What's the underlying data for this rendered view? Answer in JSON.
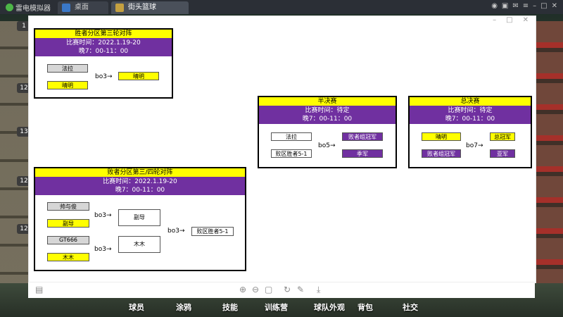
{
  "titlebar": {
    "brand": "雷电模拟器",
    "tabs": [
      {
        "label": "桌面"
      },
      {
        "label": "街头篮球"
      }
    ]
  },
  "background": {
    "left_badges": [
      "1",
      "12",
      "13",
      "12",
      "12"
    ],
    "bottom_nav": [
      "球员",
      "涂鸦",
      "技能",
      "训练营",
      "球队外观",
      "背包",
      "社交"
    ]
  },
  "bracket": {
    "winners_r3": {
      "title": "胜者分区第三轮对阵",
      "time_line": "比赛时间：2022.1.19-20",
      "time_line2": "晚7：00-11：00",
      "players": [
        "法拉",
        "晴明"
      ],
      "bo": "bo3→",
      "winner": "晴明"
    },
    "losers_r34": {
      "title": "败者分区第三/四轮对阵",
      "time_line": "比赛时间：2022.1.19-20",
      "time_line2": "晚7：00-11：00",
      "players": [
        "帅与俊",
        "副导",
        "GT666",
        "木木"
      ],
      "bo_a": "bo3→",
      "bo_b": "bo3→",
      "winner_a": "副导",
      "winner_b": "木木",
      "bo_final": "bo3→",
      "final_winner": "败区胜者5-1"
    },
    "semifinal": {
      "title": "半决赛",
      "time_line": "比赛时间：待定",
      "time_line2": "晚7：00-11：00",
      "players": [
        "法拉",
        "败区胜者5-1"
      ],
      "bo": "bo5→",
      "results": [
        "败者组冠军",
        "季军"
      ]
    },
    "final": {
      "title": "总决赛",
      "time_line": "比赛时间：待定",
      "time_line2": "晚7：00-11：00",
      "players": [
        "晴明",
        "败者组冠军"
      ],
      "bo": "bo7→",
      "results": [
        "总冠军",
        "亚军"
      ]
    }
  },
  "colors": {
    "title_yellow": "#ffff00",
    "info_purple": "#7030a0"
  }
}
